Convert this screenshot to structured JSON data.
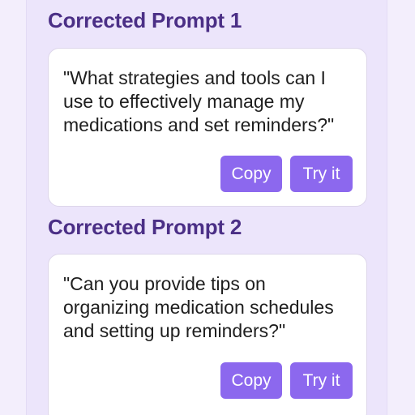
{
  "sections": [
    {
      "title": "Corrected Prompt 1",
      "prompt": "\"What strategies and tools can I use to effectively manage my medications and set reminders?\"",
      "copy_label": "Copy",
      "try_label": "Try it"
    },
    {
      "title": "Corrected Prompt 2",
      "prompt": "\"Can you provide tips on organizing medication schedules and setting up reminders?\"",
      "copy_label": "Copy",
      "try_label": "Try it"
    }
  ],
  "colors": {
    "background": "#f3eefc",
    "panel": "#ece5fb",
    "title": "#4b2f86",
    "button": "#8c68ee",
    "button_text": "#ffffff",
    "card": "#ffffff"
  }
}
